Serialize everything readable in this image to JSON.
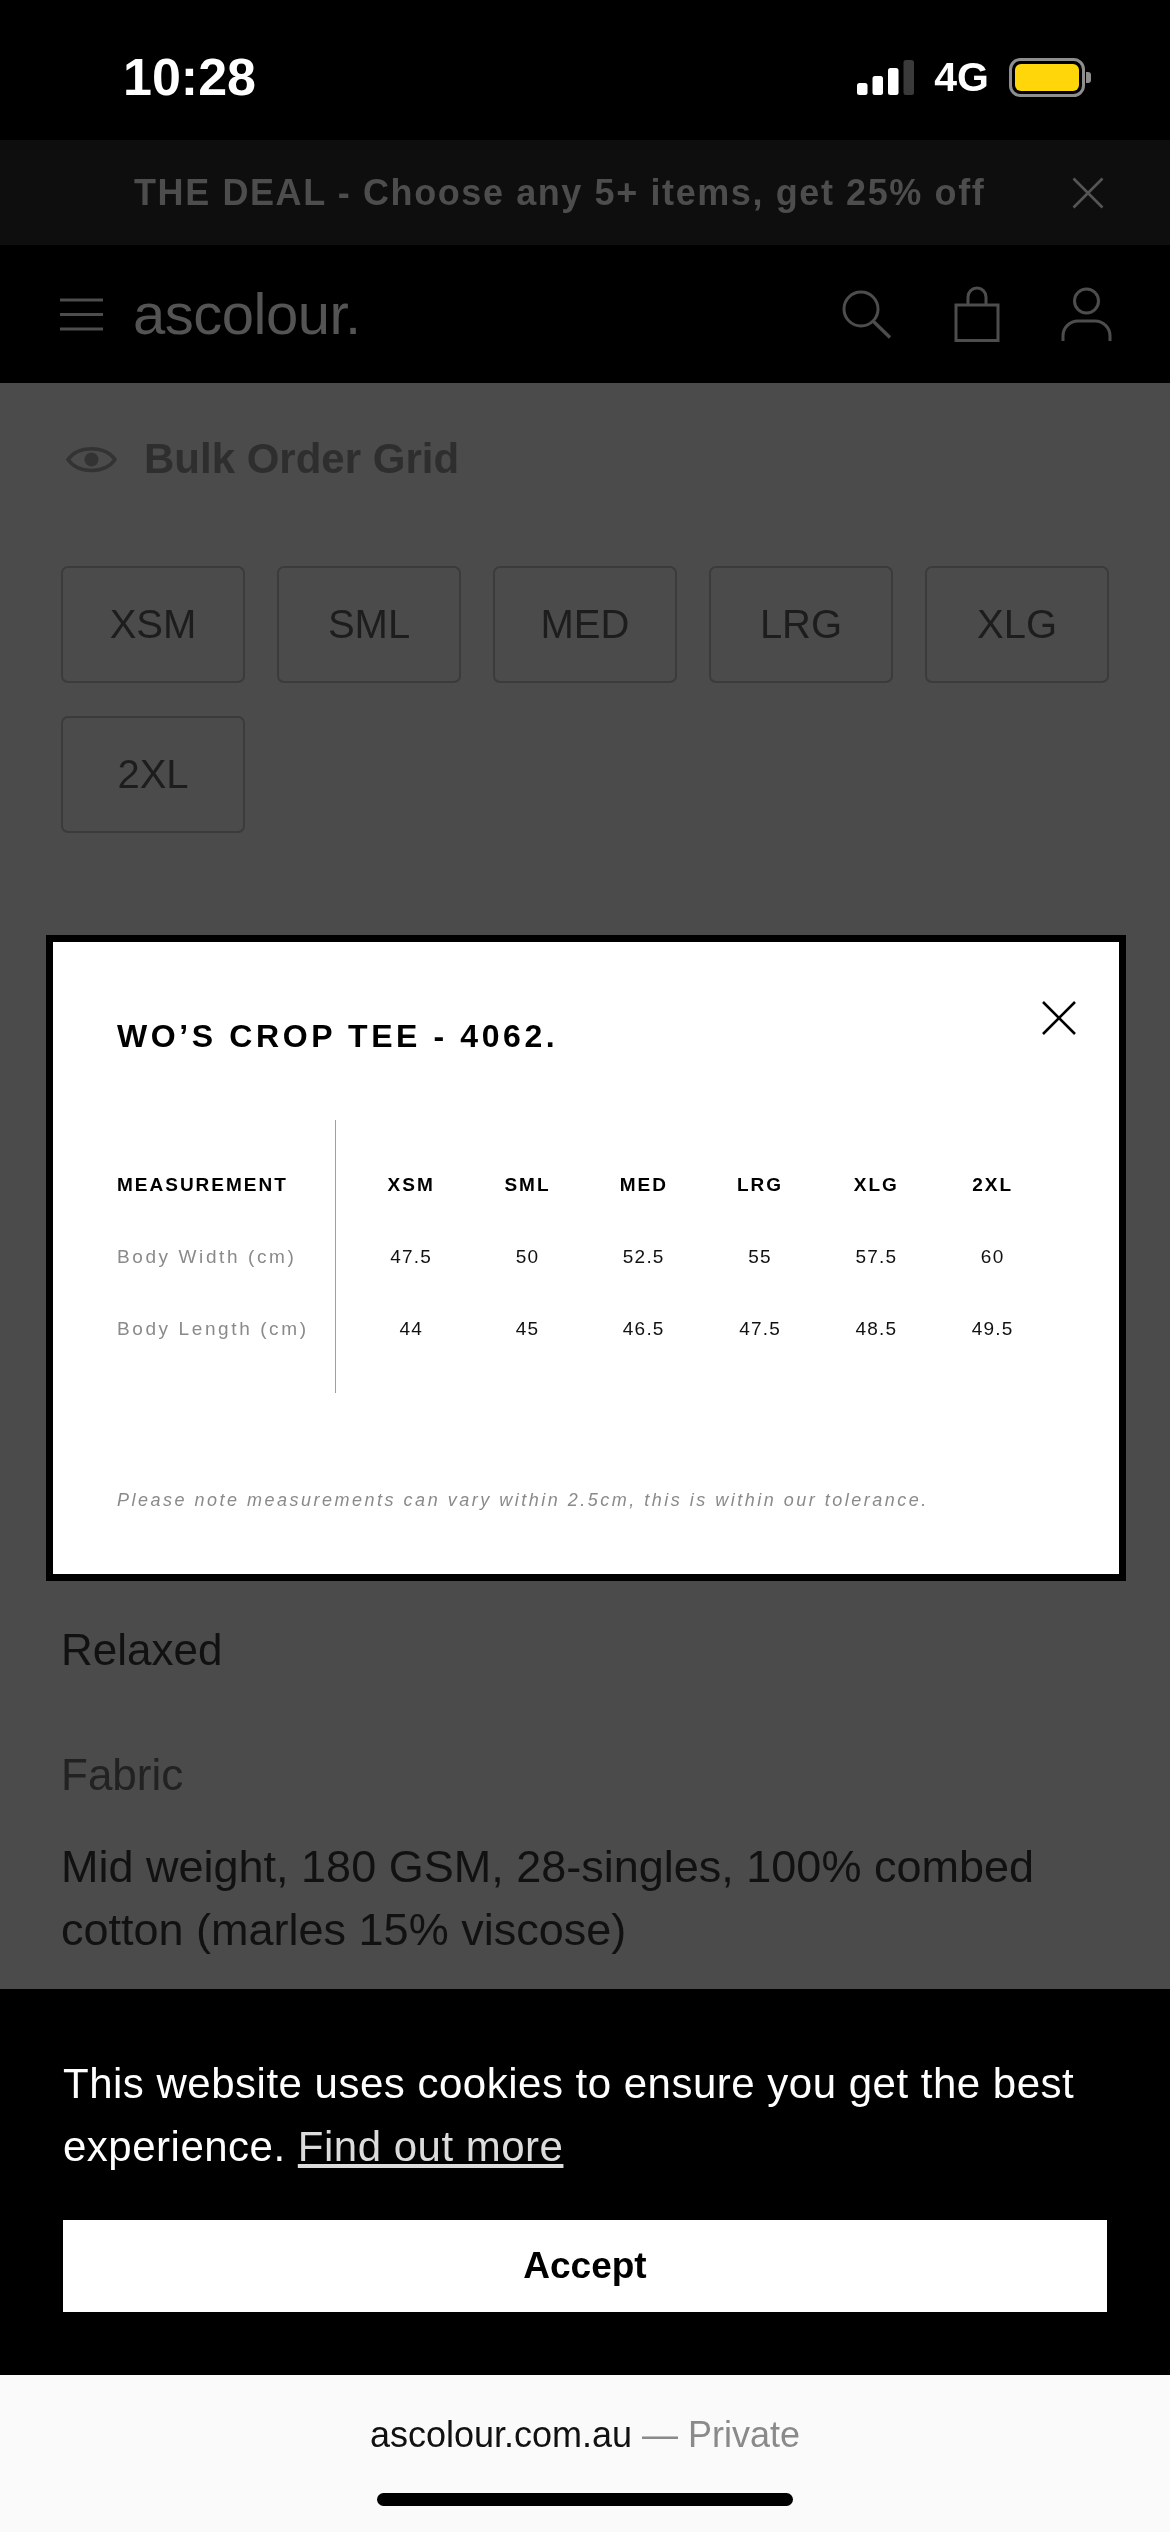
{
  "status_bar": {
    "time": "10:28",
    "network": "4G"
  },
  "promo_bar": {
    "text": "THE DEAL - Choose any 5+ items, get 25% off"
  },
  "header": {
    "logo": "ascolour."
  },
  "bulk_order": {
    "label": "Bulk Order Grid"
  },
  "sizes": [
    {
      "label": "XSM",
      "selected": false
    },
    {
      "label": "SML",
      "selected": false
    },
    {
      "label": "MED",
      "selected": false
    },
    {
      "label": "LRG",
      "selected": false
    },
    {
      "label": "XLG",
      "selected": false
    },
    {
      "label": "2XL",
      "selected": false
    }
  ],
  "size_guide": {
    "title": "WO’S CROP TEE - 4062.",
    "columns": [
      "MEASUREMENT",
      "XSM",
      "SML",
      "MED",
      "LRG",
      "XLG",
      "2XL"
    ],
    "rows": [
      {
        "label": "Body Width (cm)",
        "values": [
          "47.5",
          "50",
          "52.5",
          "55",
          "57.5",
          "60"
        ]
      },
      {
        "label": "Body Length (cm)",
        "values": [
          "44",
          "45",
          "46.5",
          "47.5",
          "48.5",
          "49.5"
        ]
      }
    ],
    "note": "Please note measurements can vary within 2.5cm, this is within our tolerance."
  },
  "details": [
    {
      "text": "Relaxed"
    },
    {
      "heading": "Fabric",
      "text": "Mid weight, 180 GSM, 28-singles, 100% combed cotton (marles 15% viscose)"
    }
  ],
  "cookie_banner": {
    "text": "This website uses cookies to ensure you get the best experience.",
    "link": "Find out more",
    "button": "Accept"
  },
  "browser_bar": {
    "domain": "ascolour.com.au",
    "privacy": "— Private"
  }
}
